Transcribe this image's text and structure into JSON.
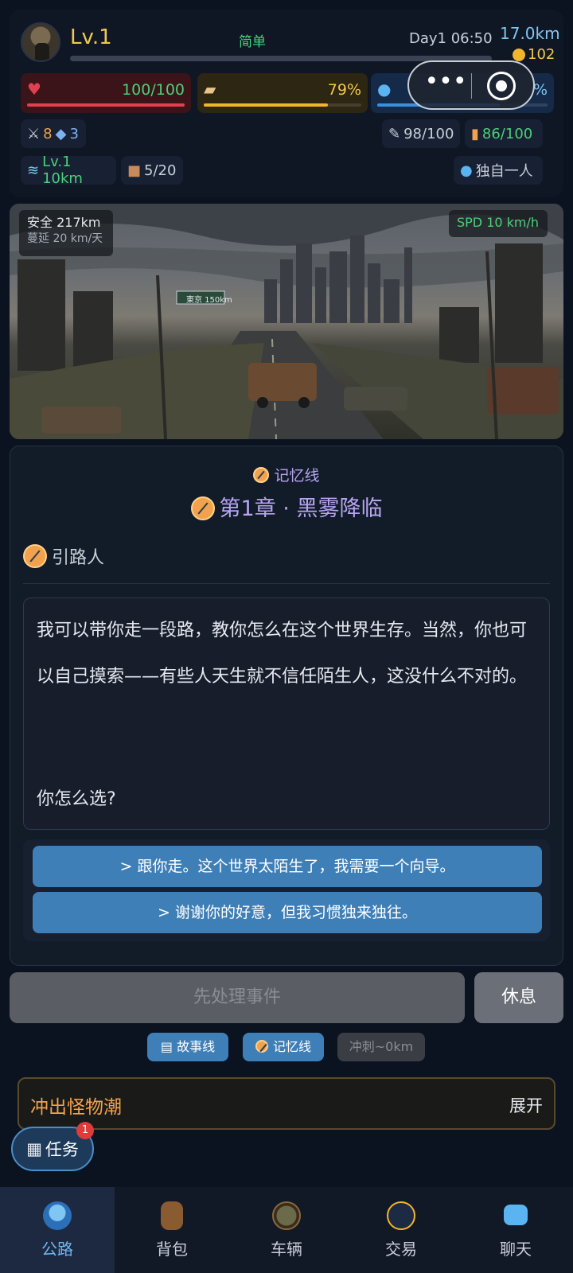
{
  "header": {
    "level": "Lv.1",
    "difficulty": "简单",
    "daytime": "Day1 06:50",
    "distance": "17.0km",
    "coins": "102"
  },
  "stats": {
    "hp": {
      "value": "100/100",
      "fraction": 1.0
    },
    "food": {
      "value": "79%",
      "fraction": 0.79
    },
    "water": {
      "value": "%",
      "fraction": 0.72
    }
  },
  "chips": {
    "attack": "8",
    "defense": "3",
    "repair": "98/100",
    "fuel": "86/100",
    "vehicle_level": "Lv.1 10km",
    "bag": "5/20",
    "team": "独自一人"
  },
  "scene": {
    "safe": "安全 217km",
    "spread": "蔓延 20 km/天",
    "speed": "SPD 10 km/h",
    "sign": "東京 150km"
  },
  "story": {
    "memory_tag": "记忆线",
    "chapter_title": "第1章 · 黑雾降临",
    "speaker": "引路人",
    "dialog": "我可以带你走一段路，教你怎么在这个世界生存。当然，你也可以自己摸索——有些人天生就不信任陌生人，这没什么不对的。",
    "question": "你怎么选?",
    "choices": [
      "> 跟你走。这个世界太陌生了，我需要一个向导。",
      "> 谢谢你的好意，但我习惯独来独往。"
    ]
  },
  "actions": {
    "handle_event": "先处理事件",
    "rest": "休息"
  },
  "mini_tabs": {
    "story": "故事线",
    "memory": "记忆线",
    "sprint": "冲刺~0km"
  },
  "quest": {
    "title": "冲出怪物潮",
    "expand": "展开"
  },
  "task": {
    "label": "任务",
    "badge": "1"
  },
  "nav": [
    {
      "label": "公路",
      "icon": "road-icon"
    },
    {
      "label": "背包",
      "icon": "backpack-icon"
    },
    {
      "label": "车辆",
      "icon": "vehicle-icon"
    },
    {
      "label": "交易",
      "icon": "trade-icon"
    },
    {
      "label": "聊天",
      "icon": "chat-icon"
    }
  ],
  "colors": {
    "accent": "#3f7fb8",
    "gold": "#f2c94c",
    "green": "#4cd07a",
    "purple": "#b8a4f2"
  }
}
